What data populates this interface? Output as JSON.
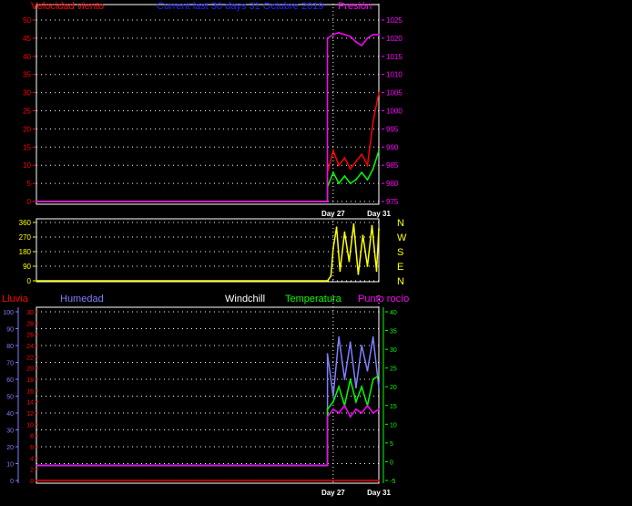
{
  "colors": {
    "background": "#000000",
    "frame": "#ffffff",
    "grid": "#ffffff",
    "wind": "#ff0000",
    "gust": "#00ff00",
    "pressure": "#ff00ff",
    "direction": "#ffff00",
    "rain": "#ff0000",
    "humidity": "#7f7fff",
    "windchill": "#ffffff",
    "temperature": "#00ff00",
    "dewpoint": "#ff00ff",
    "title": "#2222ff"
  },
  "chart_data": [
    {
      "type": "line",
      "title": "Current last 30 days 31 Octubre 2019",
      "ylabel_left": "Velocidad viento",
      "ylabel_right": "Presión",
      "ylim_left": [
        0,
        50
      ],
      "yticks_left": [
        "0",
        "5",
        "10",
        "15",
        "20",
        "25",
        "30",
        "35",
        "40",
        "45",
        "50"
      ],
      "ylim_right": [
        975,
        1025
      ],
      "yticks_right": [
        "975",
        "980",
        "985",
        "990",
        "995",
        "1000",
        "1005",
        "1010",
        "1015",
        "1020",
        "1025"
      ],
      "xlim": [
        1,
        31
      ],
      "xtick_labels": [
        {
          "day": 27,
          "label": "Day 27"
        },
        {
          "day": 31,
          "label": "Day 31"
        }
      ],
      "grid": true,
      "series": [
        {
          "key": "wind",
          "axis": "left",
          "x": [
            1,
            26.5,
            26.5,
            27,
            27.5,
            28,
            28.5,
            29,
            29.5,
            30,
            30.5,
            31
          ],
          "values": [
            0,
            0,
            8,
            14,
            10,
            12,
            9,
            11,
            13,
            10,
            22,
            30
          ]
        },
        {
          "key": "gust",
          "axis": "left",
          "x": [
            1,
            26.5,
            26.5,
            27,
            27.5,
            28,
            28.5,
            29,
            29.5,
            30,
            30.5,
            31
          ],
          "values": [
            0,
            0,
            4,
            8,
            5,
            7,
            5,
            6,
            8,
            6,
            9,
            14
          ]
        },
        {
          "key": "pressure",
          "axis": "right",
          "x": [
            1,
            26.5,
            26.5,
            27,
            27.5,
            28,
            28.5,
            29,
            29.5,
            30,
            30.5,
            31
          ],
          "values": [
            975,
            975,
            1020,
            1021,
            1021.5,
            1021,
            1020.5,
            1019,
            1018,
            1020,
            1021,
            1021
          ]
        }
      ]
    },
    {
      "type": "line",
      "ylim": [
        0,
        360
      ],
      "yticks": [
        "0",
        "90",
        "180",
        "270",
        "360"
      ],
      "compass": [
        "N",
        "W",
        "S",
        "E",
        "N"
      ],
      "xlim": [
        1,
        31
      ],
      "grid": true,
      "series": [
        {
          "key": "direction",
          "x": [
            1,
            26.5,
            26.8,
            27,
            27.3,
            27.6,
            28,
            28.4,
            28.8,
            29.2,
            29.6,
            30,
            30.4,
            30.8,
            31
          ],
          "values": [
            0,
            0,
            30,
            200,
            330,
            60,
            300,
            120,
            350,
            40,
            280,
            90,
            340,
            60,
            320
          ]
        }
      ]
    },
    {
      "type": "line",
      "labels": {
        "rain": "Lluvia",
        "humidity": "Humedad",
        "windchill": "Windchill",
        "temperature": "Temperatura",
        "dewpoint": "Punto rocío"
      },
      "ylim_humidity": [
        0,
        100
      ],
      "yticks_humidity": [
        "0",
        "10",
        "20",
        "30",
        "40",
        "50",
        "60",
        "70",
        "80",
        "90",
        "100"
      ],
      "ylim_rain": [
        0,
        30
      ],
      "yticks_rain": [
        "0",
        "2",
        "4",
        "6",
        "8",
        "10",
        "12",
        "14",
        "16",
        "18",
        "20",
        "22",
        "24",
        "26",
        "28",
        "30"
      ],
      "ylim_temperature": [
        -5,
        40
      ],
      "yticks_temperature": [
        "-5",
        "0",
        "5",
        "10",
        "15",
        "20",
        "25",
        "30",
        "35",
        "40"
      ],
      "xlim": [
        1,
        31
      ],
      "xtick_labels": [
        {
          "day": 27,
          "label": "Day 27"
        },
        {
          "day": 31,
          "label": "Day 31"
        }
      ],
      "grid": true,
      "series": [
        {
          "key": "rain",
          "axis": "rain",
          "x": [
            1,
            31
          ],
          "values": [
            0,
            0
          ]
        },
        {
          "key": "humidity",
          "axis": "humidity",
          "x": [
            1,
            26.5,
            26.5,
            27,
            27.5,
            28,
            28.5,
            29,
            29.5,
            30,
            30.5,
            31
          ],
          "values": [
            9,
            9,
            75,
            50,
            85,
            60,
            82,
            55,
            80,
            65,
            85,
            55
          ]
        },
        {
          "key": "temperature",
          "axis": "temperature",
          "x": [
            1,
            26.5,
            26.5,
            27,
            27.5,
            28,
            28.5,
            29,
            29.5,
            30,
            30.5,
            31
          ],
          "values": [
            -1,
            -1,
            14,
            16,
            20,
            15,
            22,
            16,
            20,
            15,
            22,
            23
          ]
        },
        {
          "key": "dewpoint",
          "axis": "temperature",
          "x": [
            1,
            26.5,
            26.5,
            27,
            27.5,
            28,
            28.5,
            29,
            29.5,
            30,
            30.5,
            31
          ],
          "values": [
            -1,
            -1,
            12,
            14,
            13,
            15,
            12,
            14,
            13,
            15,
            13,
            14
          ]
        }
      ]
    }
  ]
}
